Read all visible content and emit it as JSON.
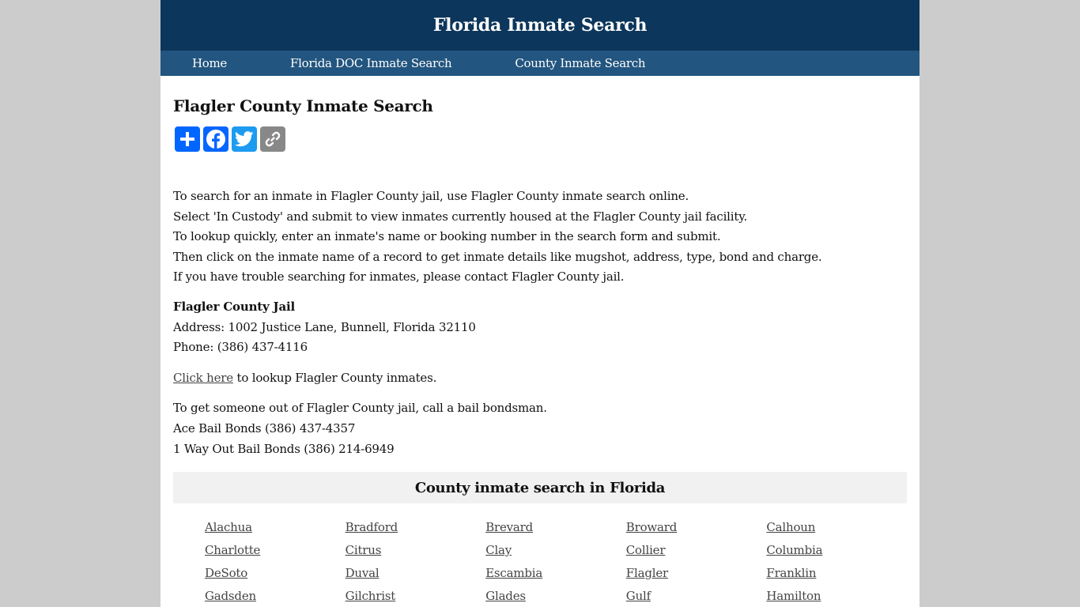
{
  "site": {
    "title": "Florida Inmate Search"
  },
  "nav": {
    "items": [
      {
        "label": "Home"
      },
      {
        "label": "Florida DOC Inmate Search"
      },
      {
        "label": "County Inmate Search"
      }
    ]
  },
  "page": {
    "heading": "Flagler County Inmate Search"
  },
  "share": {
    "buttons": [
      {
        "name": "share",
        "icon": "plus-icon",
        "color": "#0166ff"
      },
      {
        "name": "facebook",
        "icon": "facebook-icon",
        "color": "#0866ff"
      },
      {
        "name": "twitter",
        "icon": "twitter-icon",
        "color": "#1d9bf0"
      },
      {
        "name": "copy-link",
        "icon": "link-icon",
        "color": "#888888"
      }
    ]
  },
  "intro": {
    "lines": [
      "To search for an inmate in Flagler County jail, use Flagler County inmate search online.",
      "Select 'In Custody' and submit to view inmates currently housed at the Flagler County jail facility.",
      "To lookup quickly, enter an inmate's name or booking number in the search form and submit.",
      "Then click on the inmate name of a record to get inmate details like mugshot, address, type, bond and charge.",
      "If you have trouble searching for inmates, please contact Flagler County jail."
    ]
  },
  "jail": {
    "name": "Flagler County Jail",
    "address": "Address: 1002 Justice Lane, Bunnell, Florida 32110",
    "phone": "Phone: (386) 437-4116"
  },
  "lookup": {
    "link_text": "Click here",
    "rest_text": " to lookup Flagler County inmates."
  },
  "bail": {
    "lines": [
      "To get someone out of Flagler County jail, call a bail bondsman.",
      "Ace Bail Bonds (386) 437-4357",
      "1 Way Out Bail Bonds (386) 214-6949"
    ]
  },
  "counties": {
    "heading": "County inmate search in Florida",
    "items": [
      "Alachua",
      "Bradford",
      "Brevard",
      "Broward",
      "Calhoun",
      "Charlotte",
      "Citrus",
      "Clay",
      "Collier",
      "Columbia",
      "DeSoto",
      "Duval",
      "Escambia",
      "Flagler",
      "Franklin",
      "Gadsden",
      "Gilchrist",
      "Glades",
      "Gulf",
      "Hamilton"
    ]
  },
  "colors": {
    "header_bg": "#0c365b",
    "nav_bg": "#22557f",
    "page_bg": "#cccccc",
    "section_heading_bg": "#f1f1f1",
    "link": "#444444"
  }
}
